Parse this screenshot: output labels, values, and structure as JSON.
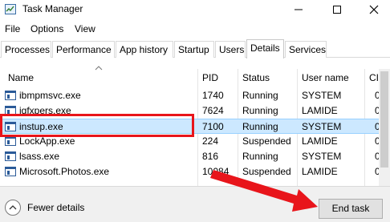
{
  "window": {
    "title": "Task Manager",
    "icon": "task-manager-icon",
    "controls": [
      "minimize-icon",
      "maximize-icon",
      "close-icon"
    ]
  },
  "menu": [
    "File",
    "Options",
    "View"
  ],
  "tabs": [
    "Processes",
    "Performance",
    "App history",
    "Startup",
    "Users",
    "Details",
    "Services"
  ],
  "active_tab": "Details",
  "table": {
    "columns": [
      "Name",
      "PID",
      "Status",
      "User name",
      "CI"
    ],
    "rows": [
      {
        "name": "ibmpmsvc.exe",
        "pid": "1740",
        "status": "Running",
        "user": "SYSTEM",
        "extra": "0"
      },
      {
        "name": "igfxpers.exe",
        "pid": "7624",
        "status": "Running",
        "user": "LAMIDE",
        "extra": "0"
      },
      {
        "name": "instup.exe",
        "pid": "7100",
        "status": "Running",
        "user": "SYSTEM",
        "extra": "0"
      },
      {
        "name": "LockApp.exe",
        "pid": "224",
        "status": "Suspended",
        "user": "LAMIDE",
        "extra": "0"
      },
      {
        "name": "lsass.exe",
        "pid": "816",
        "status": "Running",
        "user": "SYSTEM",
        "extra": "0"
      },
      {
        "name": "Microsoft.Photos.exe",
        "pid": "10084",
        "status": "Suspended",
        "user": "LAMIDE",
        "extra": "0"
      }
    ],
    "selected_row": "instup.exe"
  },
  "footer": {
    "fewer_details": "Fewer details",
    "end_task": "End task"
  },
  "annotation_color": "#e8151b",
  "selection_color": "#cce8ff"
}
